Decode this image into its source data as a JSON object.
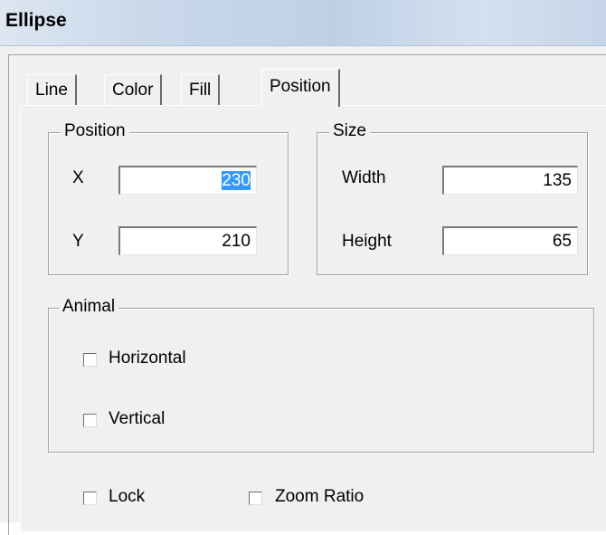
{
  "window": {
    "title": "Ellipse"
  },
  "tabs": [
    {
      "label": "Line"
    },
    {
      "label": "Color"
    },
    {
      "label": "Fill"
    },
    {
      "label": "Position",
      "active": true
    }
  ],
  "position_group": {
    "legend": "Position",
    "x": {
      "label": "X",
      "value": "230"
    },
    "y": {
      "label": "Y",
      "value": "210"
    }
  },
  "size_group": {
    "legend": "Size",
    "width": {
      "label": "Width",
      "value": "135"
    },
    "height": {
      "label": "Height",
      "value": "65"
    }
  },
  "animal_group": {
    "legend": "Animal",
    "horizontal": {
      "label": "Horizontal",
      "checked": false
    },
    "vertical": {
      "label": "Vertical",
      "checked": false
    }
  },
  "bottom": {
    "lock": {
      "label": "Lock",
      "checked": false
    },
    "zoom_ratio": {
      "label": "Zoom Ratio",
      "checked": false
    }
  },
  "colors": {
    "selection": "#3399ff",
    "titlebar": "#c9d8ea",
    "face": "#f0f0f0"
  }
}
